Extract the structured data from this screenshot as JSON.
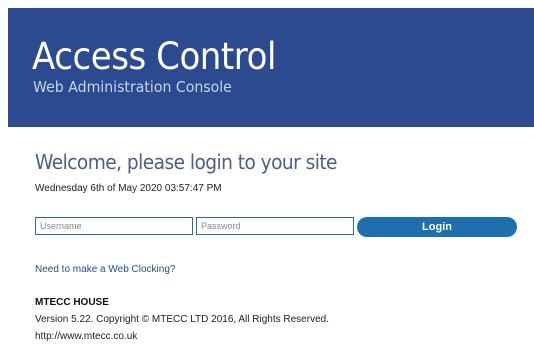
{
  "banner": {
    "title": "Access Control",
    "subtitle": "Web Administration Console"
  },
  "login": {
    "welcome": "Welcome, please login to your site",
    "datetime": "Wednesday 6th of May 2020 03:57:47 PM",
    "username_placeholder": "Username",
    "password_placeholder": "Password",
    "login_label": "Login"
  },
  "links": {
    "web_clocking": "Need to make a Web Clocking?"
  },
  "footer": {
    "company": "MTECC HOUSE",
    "version": "Version 5.22.  Copyright © MTECC LTD 2016,  All Rights Reserved.",
    "url": "http://www.mtecc.co.uk"
  },
  "colors": {
    "banner_background": "#2b4a8f",
    "button_background": "#1f6fae",
    "input_border": "#2b6aa8"
  }
}
